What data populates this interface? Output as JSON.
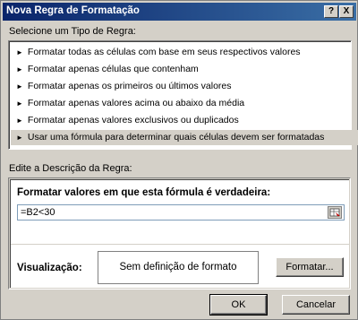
{
  "window": {
    "title": "Nova Regra de Formatação",
    "help_label": "?",
    "close_label": "X"
  },
  "rule_type": {
    "label": "Selecione um Tipo de Regra:",
    "items": [
      {
        "label": "Formatar todas as células com base em seus respectivos valores",
        "selected": false
      },
      {
        "label": "Formatar apenas células que contenham",
        "selected": false
      },
      {
        "label": "Formatar apenas os primeiros ou últimos valores",
        "selected": false
      },
      {
        "label": "Formatar apenas valores acima ou abaixo da média",
        "selected": false
      },
      {
        "label": "Formatar apenas valores exclusivos ou duplicados",
        "selected": false
      },
      {
        "label": "Usar uma fórmula para determinar quais células devem ser formatadas",
        "selected": true
      }
    ]
  },
  "description": {
    "label": "Edite a Descrição da Regra:",
    "formula_heading": "Formatar valores em que esta fórmula é verdadeira:",
    "formula_value": "=B2<30",
    "preview_label": "Visualização:",
    "preview_text": "Sem definição de formato",
    "format_button": "Formatar..."
  },
  "footer": {
    "ok_label": "OK",
    "cancel_label": "Cancelar"
  },
  "colors": {
    "title_gradient_start": "#0a246a",
    "title_gradient_end": "#3a6ea5",
    "dialog_face": "#d4d0c8"
  },
  "icons": {
    "rule_bullet": "right-triangle-icon",
    "range_picker": "range-picker-icon"
  }
}
